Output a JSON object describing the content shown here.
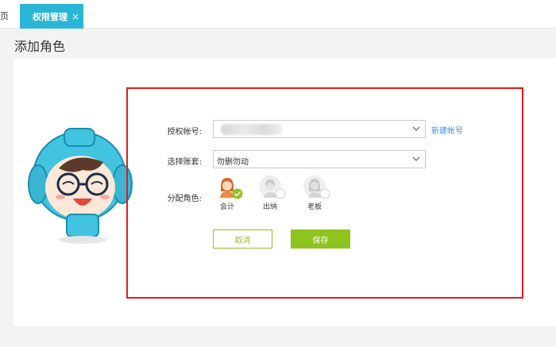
{
  "tabs": {
    "home_label": "页",
    "active_label": "权限管理",
    "close_glyph": "×"
  },
  "page": {
    "title": "添加角色"
  },
  "form": {
    "account_label": "授权帐号:",
    "account_value": "",
    "new_account_link": "新建帐号",
    "ledger_label": "选择账套:",
    "ledger_value": "勿删勿动",
    "role_label": "分配角色:",
    "roles": [
      {
        "name": "会计",
        "selected": true
      },
      {
        "name": "出纳",
        "selected": false
      },
      {
        "name": "老板",
        "selected": false
      }
    ],
    "cancel_label": "取消",
    "save_label": "保存"
  },
  "colors": {
    "accent": "#29b6d6",
    "primary_green": "#8fc31f",
    "link": "#3f8de0",
    "highlight_frame": "#e11b1b"
  }
}
